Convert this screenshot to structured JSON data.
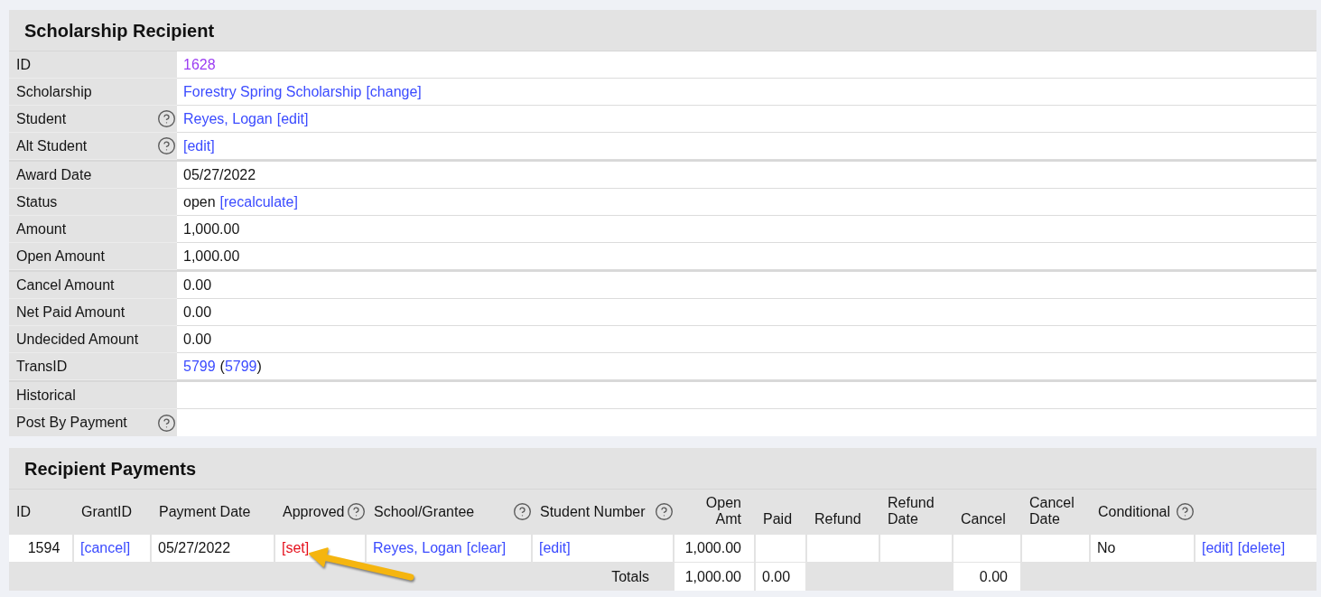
{
  "record": {
    "title": "Scholarship Recipient",
    "groups": [
      {
        "rows": [
          {
            "label": "ID",
            "help": false,
            "value": [
              {
                "kind": "visited_link",
                "text": "1628"
              }
            ]
          },
          {
            "label": "Scholarship",
            "help": false,
            "value": [
              {
                "kind": "link",
                "text": "Forestry Spring Scholarship"
              },
              {
                "kind": "link",
                "text": "[change]"
              }
            ]
          },
          {
            "label": "Student",
            "help": true,
            "value": [
              {
                "kind": "link",
                "text": "Reyes, Logan"
              },
              {
                "kind": "link",
                "text": "[edit]"
              }
            ]
          },
          {
            "label": "Alt Student",
            "help": true,
            "value": [
              {
                "kind": "link",
                "text": "[edit]"
              }
            ]
          }
        ]
      },
      {
        "rows": [
          {
            "label": "Award Date",
            "help": false,
            "value": [
              {
                "kind": "text",
                "text": "05/27/2022"
              }
            ]
          },
          {
            "label": "Status",
            "help": false,
            "value": [
              {
                "kind": "text",
                "text": "open"
              },
              {
                "kind": "link",
                "text": "[recalculate]"
              }
            ]
          },
          {
            "label": "Amount",
            "help": false,
            "value": [
              {
                "kind": "text",
                "text": "1,000.00"
              }
            ]
          },
          {
            "label": "Open Amount",
            "help": false,
            "value": [
              {
                "kind": "text",
                "text": "1,000.00"
              }
            ]
          }
        ]
      },
      {
        "rows": [
          {
            "label": "Cancel Amount",
            "help": false,
            "value": [
              {
                "kind": "text",
                "text": "0.00"
              }
            ]
          },
          {
            "label": "Net Paid Amount",
            "help": false,
            "value": [
              {
                "kind": "text",
                "text": "0.00"
              }
            ]
          },
          {
            "label": "Undecided Amount",
            "help": false,
            "value": [
              {
                "kind": "text",
                "text": "0.00"
              }
            ]
          },
          {
            "label": "TransID",
            "help": false,
            "value": [
              {
                "kind": "link",
                "text": "5799"
              },
              {
                "kind": "group",
                "parts": [
                  {
                    "kind": "text",
                    "text": "("
                  },
                  {
                    "kind": "link",
                    "text": "5799"
                  },
                  {
                    "kind": "text",
                    "text": ")"
                  }
                ]
              }
            ]
          }
        ]
      },
      {
        "rows": [
          {
            "label": "Historical",
            "help": false
          },
          {
            "label": "Post By Payment",
            "help": true
          }
        ]
      }
    ]
  },
  "payments": {
    "title": "Recipient Payments",
    "columns": [
      {
        "lines": [
          "ID"
        ],
        "help": false
      },
      {
        "lines": [
          "GrantID"
        ],
        "help": false
      },
      {
        "lines": [
          "Payment Date"
        ],
        "help": false
      },
      {
        "lines": [
          "Approved"
        ],
        "help": true
      },
      {
        "lines": [
          "School/Grantee"
        ],
        "help": true
      },
      {
        "lines": [
          "Student Number"
        ],
        "help": true
      },
      {
        "lines": [
          "Open",
          "Amt"
        ],
        "help": false
      },
      {
        "lines": [
          "Paid"
        ],
        "help": false
      },
      {
        "lines": [
          "Refund"
        ],
        "help": false
      },
      {
        "lines": [
          "Refund",
          "Date"
        ],
        "help": false
      },
      {
        "lines": [
          "Cancel"
        ],
        "help": false
      },
      {
        "lines": [
          "Cancel",
          "Date"
        ],
        "help": false
      },
      {
        "lines": [
          "Conditional"
        ],
        "help": true
      }
    ],
    "rows": [
      {
        "cells": [
          {
            "parts": [
              {
                "kind": "text",
                "text": "1594"
              }
            ]
          },
          {
            "parts": [
              {
                "kind": "link",
                "text": "[cancel]"
              }
            ]
          },
          {
            "parts": [
              {
                "kind": "text",
                "text": "05/27/2022"
              }
            ]
          },
          {
            "parts": [
              {
                "kind": "alert_link",
                "text": "[set]"
              }
            ]
          },
          {
            "parts": [
              {
                "kind": "link",
                "text": "Reyes, Logan"
              },
              {
                "kind": "link",
                "text": "[clear]"
              }
            ]
          },
          {
            "parts": [
              {
                "kind": "link",
                "text": "[edit]"
              }
            ]
          },
          {
            "parts": [
              {
                "kind": "text",
                "text": "1,000.00"
              }
            ]
          },
          {},
          {},
          {},
          {},
          {},
          {
            "parts": [
              {
                "kind": "text",
                "text": "No"
              }
            ]
          },
          {
            "parts": [
              {
                "kind": "link",
                "text": "[edit]"
              },
              {
                "kind": "link",
                "text": "[delete]"
              }
            ]
          }
        ]
      }
    ],
    "totals": {
      "label": "Totals",
      "open_amt": "1,000.00",
      "paid": "0.00",
      "cancel": "0.00"
    }
  }
}
